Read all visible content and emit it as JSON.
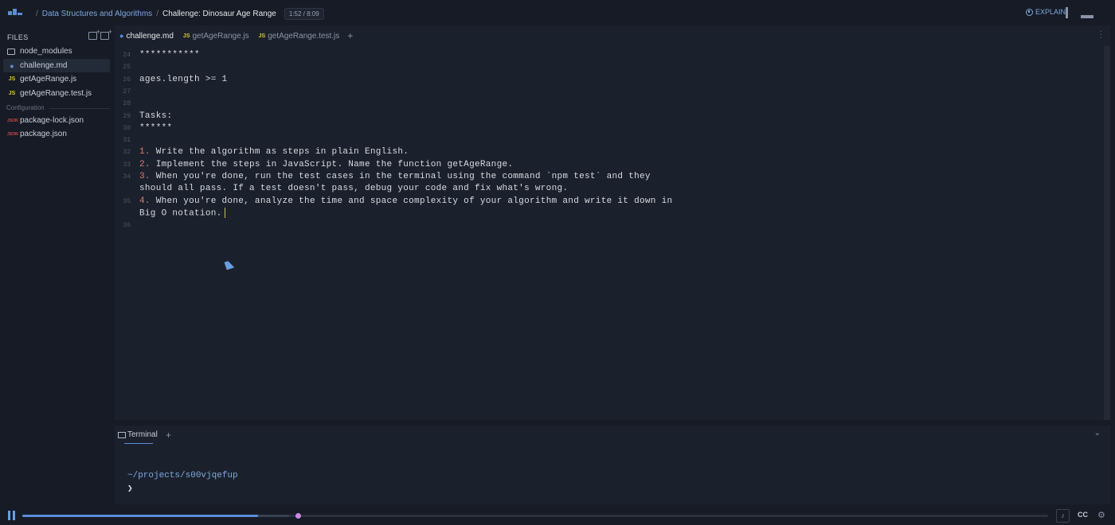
{
  "header": {
    "breadcrumb_course": "Data Structures and Algorithms",
    "breadcrumb_sep": "/",
    "breadcrumb_challenge": "Challenge: Dinosaur Age Range",
    "time": "1:52 / 8:09",
    "explain_label": "EXPLAIN"
  },
  "sidebar": {
    "files_label": "FILES",
    "items": [
      {
        "label": "node_modules",
        "icon": "folder-icon"
      },
      {
        "label": "challenge.md",
        "icon": "markdown-icon"
      },
      {
        "label": "getAgeRange.js",
        "icon": "js-icon",
        "badge": "JS"
      },
      {
        "label": "getAgeRange.test.js",
        "icon": "js-icon",
        "badge": "JS"
      }
    ],
    "config_label": "Configuration",
    "config_items": [
      {
        "label": "package-lock.json",
        "badge": "JSON"
      },
      {
        "label": "package.json",
        "badge": "JSON"
      }
    ]
  },
  "editor": {
    "tabs": [
      {
        "label": "challenge.md",
        "icon": "markdown-icon"
      },
      {
        "label": "getAgeRange.js",
        "badge": "JS"
      },
      {
        "label": "getAgeRange.test.js",
        "badge": "JS"
      }
    ],
    "add_tab": "+",
    "lines": [
      {
        "n": "24",
        "text": "***********"
      },
      {
        "n": "25",
        "text": ""
      },
      {
        "n": "26",
        "text": "ages.length >= 1"
      },
      {
        "n": "27",
        "text": ""
      },
      {
        "n": "28",
        "text": ""
      },
      {
        "n": "29",
        "text": "Tasks:"
      },
      {
        "n": "30",
        "text": "******"
      },
      {
        "n": "31",
        "text": ""
      },
      {
        "n": "32",
        "num": "1.",
        "text": " Write the algorithm as steps in plain English."
      },
      {
        "n": "33",
        "num": "2.",
        "text": " Implement the steps in JavaScript. Name the function getAgeRange."
      },
      {
        "n": "34",
        "num": "3.",
        "text": " When you're done, run the test cases in the terminal using the command `npm test` and they"
      },
      {
        "n": "",
        "text": "should all pass. If a test doesn't pass, debug your code and fix what's wrong."
      },
      {
        "n": "35",
        "num": "4.",
        "text": " When you're done, analyze the time and space complexity of your algorithm and write it down in"
      },
      {
        "n": "",
        "text": "Big O notation."
      },
      {
        "n": "36",
        "text": ""
      }
    ]
  },
  "terminal": {
    "tab_label": "Terminal",
    "add": "+",
    "path": "~/projects/s00vjqefup",
    "prompt": "❯"
  },
  "player": {
    "progress_fraction": 0.23,
    "buffered_fraction": 0.26,
    "cc_label": "CC"
  }
}
